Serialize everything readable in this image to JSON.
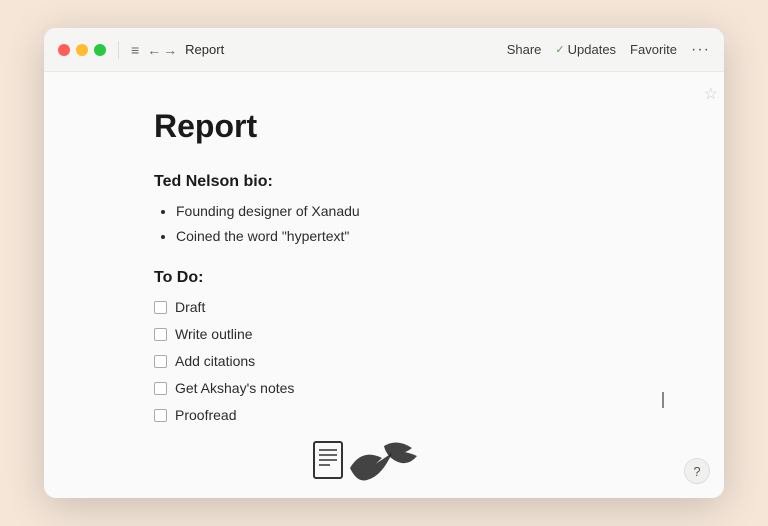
{
  "window": {
    "title": "Report"
  },
  "titlebar": {
    "traffic": {
      "close_label": "",
      "minimize_label": "",
      "maximize_label": ""
    },
    "menu_icon": "≡",
    "back_arrow": "←",
    "forward_arrow": "→",
    "title": "Report",
    "share_label": "Share",
    "updates_label": "Updates",
    "updates_check": "✓",
    "favorite_label": "Favorite",
    "more_label": "···"
  },
  "document": {
    "title": "Report",
    "bio_heading": "Ted Nelson bio:",
    "bio_bullets": [
      "Founding designer of Xanadu",
      "Coined the word \"hypertext\""
    ],
    "todo_heading": "To Do:",
    "todo_items": [
      {
        "label": "Draft",
        "checked": false
      },
      {
        "label": "Write outline",
        "checked": false
      },
      {
        "label": "Add citations",
        "checked": false
      },
      {
        "label": "Get Akshay's notes",
        "checked": false
      },
      {
        "label": "Proofread",
        "checked": false
      }
    ]
  },
  "help_button_label": "?"
}
